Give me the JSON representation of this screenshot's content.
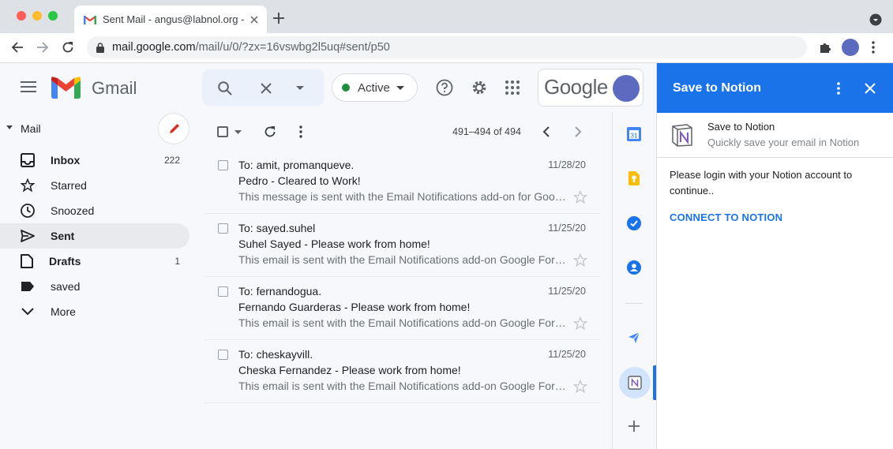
{
  "browser": {
    "tab_title": "Sent Mail - angus@labnol.org - ",
    "url_host": "mail.google.com",
    "url_path": "/mail/u/0/?zx=16vswbg2l5uq#sent/p50"
  },
  "header": {
    "app_name": "Gmail",
    "status_label": "Active",
    "google_logo": "Google"
  },
  "sidebar": {
    "section_label": "Mail",
    "items": [
      {
        "label": "Inbox",
        "count": "222",
        "icon": "inbox-icon"
      },
      {
        "label": "Starred",
        "count": "",
        "icon": "star-icon"
      },
      {
        "label": "Snoozed",
        "count": "",
        "icon": "clock-icon"
      },
      {
        "label": "Sent",
        "count": "",
        "icon": "send-icon"
      },
      {
        "label": "Drafts",
        "count": "1",
        "icon": "draft-icon"
      },
      {
        "label": "saved",
        "count": "",
        "icon": "label-icon"
      },
      {
        "label": "More",
        "count": "",
        "icon": "chevron-down-icon"
      }
    ]
  },
  "toolbar": {
    "pagination": "491–494 of 494"
  },
  "emails": [
    {
      "to": "To: amit, promanqueve.",
      "date": "11/28/20",
      "subject": "Pedro - Cleared to Work!",
      "snippet": "This message is sent with the Email Notifications add-on for Google Forms"
    },
    {
      "to": "To: sayed.suhel",
      "date": "11/25/20",
      "subject": "Suhel Sayed - Please work from home!",
      "snippet": "This email is sent with the Email Notifications add-on Google Forms"
    },
    {
      "to": "To: fernandogua.",
      "date": "11/25/20",
      "subject": "Fernando Guarderas - Please work from home!",
      "snippet": "This email is sent with the Email Notifications add-on Google Forms"
    },
    {
      "to": "To: cheskayvill.",
      "date": "11/25/20",
      "subject": "Cheska Fernandez - Please work from home!",
      "snippet": "This email is sent with the Email Notifications add-on Google Forms"
    }
  ],
  "notion_panel": {
    "title": "Save to Notion",
    "addon_name": "Save to Notion",
    "addon_subtitle": "Quickly save your email in Notion",
    "message": "Please login with your Notion account to continue..",
    "connect_label": "CONNECT TO NOTION"
  },
  "colors": {
    "accent": "#1a73e8",
    "active_dot": "#1e8e3e",
    "compose_pencil": "#d93025"
  }
}
